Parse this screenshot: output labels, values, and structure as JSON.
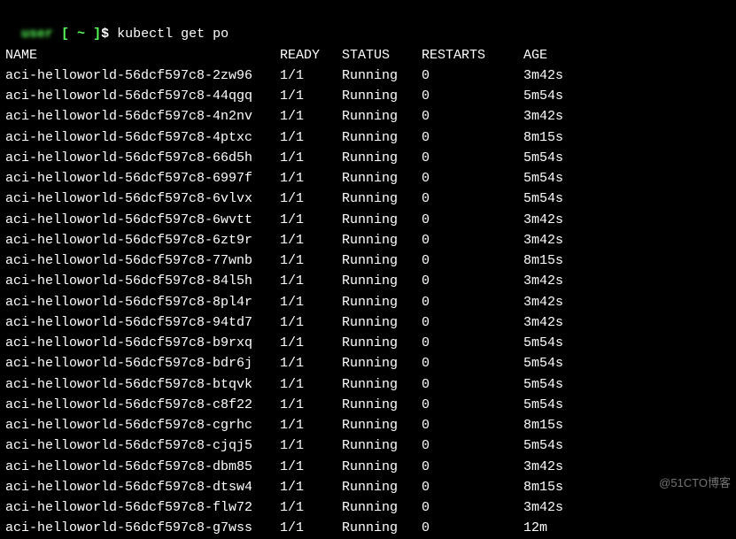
{
  "prompt": {
    "user": "user",
    "bracket_open": "[",
    "tilde": "~",
    "bracket_close": "]",
    "dollar": "$",
    "command": "kubectl get po"
  },
  "headers": {
    "name": "NAME",
    "ready": "READY",
    "status": "STATUS",
    "restarts": "RESTARTS",
    "age": "AGE"
  },
  "pods": [
    {
      "name": "aci-helloworld-56dcf597c8-2zw96",
      "ready": "1/1",
      "status": "Running",
      "restarts": "0",
      "age": "3m42s"
    },
    {
      "name": "aci-helloworld-56dcf597c8-44qgq",
      "ready": "1/1",
      "status": "Running",
      "restarts": "0",
      "age": "5m54s"
    },
    {
      "name": "aci-helloworld-56dcf597c8-4n2nv",
      "ready": "1/1",
      "status": "Running",
      "restarts": "0",
      "age": "3m42s"
    },
    {
      "name": "aci-helloworld-56dcf597c8-4ptxc",
      "ready": "1/1",
      "status": "Running",
      "restarts": "0",
      "age": "8m15s"
    },
    {
      "name": "aci-helloworld-56dcf597c8-66d5h",
      "ready": "1/1",
      "status": "Running",
      "restarts": "0",
      "age": "5m54s"
    },
    {
      "name": "aci-helloworld-56dcf597c8-6997f",
      "ready": "1/1",
      "status": "Running",
      "restarts": "0",
      "age": "5m54s"
    },
    {
      "name": "aci-helloworld-56dcf597c8-6vlvx",
      "ready": "1/1",
      "status": "Running",
      "restarts": "0",
      "age": "5m54s"
    },
    {
      "name": "aci-helloworld-56dcf597c8-6wvtt",
      "ready": "1/1",
      "status": "Running",
      "restarts": "0",
      "age": "3m42s"
    },
    {
      "name": "aci-helloworld-56dcf597c8-6zt9r",
      "ready": "1/1",
      "status": "Running",
      "restarts": "0",
      "age": "3m42s"
    },
    {
      "name": "aci-helloworld-56dcf597c8-77wnb",
      "ready": "1/1",
      "status": "Running",
      "restarts": "0",
      "age": "8m15s"
    },
    {
      "name": "aci-helloworld-56dcf597c8-84l5h",
      "ready": "1/1",
      "status": "Running",
      "restarts": "0",
      "age": "3m42s"
    },
    {
      "name": "aci-helloworld-56dcf597c8-8pl4r",
      "ready": "1/1",
      "status": "Running",
      "restarts": "0",
      "age": "3m42s"
    },
    {
      "name": "aci-helloworld-56dcf597c8-94td7",
      "ready": "1/1",
      "status": "Running",
      "restarts": "0",
      "age": "3m42s"
    },
    {
      "name": "aci-helloworld-56dcf597c8-b9rxq",
      "ready": "1/1",
      "status": "Running",
      "restarts": "0",
      "age": "5m54s"
    },
    {
      "name": "aci-helloworld-56dcf597c8-bdr6j",
      "ready": "1/1",
      "status": "Running",
      "restarts": "0",
      "age": "5m54s"
    },
    {
      "name": "aci-helloworld-56dcf597c8-btqvk",
      "ready": "1/1",
      "status": "Running",
      "restarts": "0",
      "age": "5m54s"
    },
    {
      "name": "aci-helloworld-56dcf597c8-c8f22",
      "ready": "1/1",
      "status": "Running",
      "restarts": "0",
      "age": "5m54s"
    },
    {
      "name": "aci-helloworld-56dcf597c8-cgrhc",
      "ready": "1/1",
      "status": "Running",
      "restarts": "0",
      "age": "8m15s"
    },
    {
      "name": "aci-helloworld-56dcf597c8-cjqj5",
      "ready": "1/1",
      "status": "Running",
      "restarts": "0",
      "age": "5m54s"
    },
    {
      "name": "aci-helloworld-56dcf597c8-dbm85",
      "ready": "1/1",
      "status": "Running",
      "restarts": "0",
      "age": "3m42s"
    },
    {
      "name": "aci-helloworld-56dcf597c8-dtsw4",
      "ready": "1/1",
      "status": "Running",
      "restarts": "0",
      "age": "8m15s"
    },
    {
      "name": "aci-helloworld-56dcf597c8-flw72",
      "ready": "1/1",
      "status": "Running",
      "restarts": "0",
      "age": "3m42s"
    },
    {
      "name": "aci-helloworld-56dcf597c8-g7wss",
      "ready": "1/1",
      "status": "Running",
      "restarts": "0",
      "age": "12m"
    }
  ],
  "watermark": "@51CTO博客"
}
